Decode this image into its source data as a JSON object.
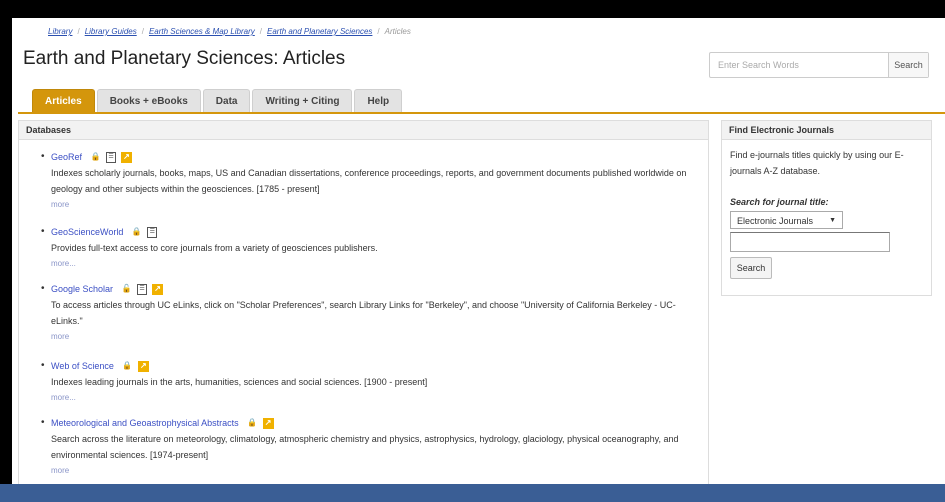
{
  "breadcrumb": {
    "items": [
      "Library",
      "Library Guides",
      "Earth Sciences & Map Library",
      "Earth and Planetary Sciences",
      "Articles"
    ],
    "separator": "/"
  },
  "page_title": "Earth and Planetary Sciences: Articles",
  "search": {
    "placeholder": "Enter Search Words",
    "button_label": "Search"
  },
  "tabs": [
    {
      "label": "Articles",
      "active": true
    },
    {
      "label": "Books + eBooks",
      "active": false
    },
    {
      "label": "Data",
      "active": false
    },
    {
      "label": "Writing + Citing",
      "active": false
    },
    {
      "label": "Help",
      "active": false
    }
  ],
  "databases_box": {
    "title": "Databases",
    "items": [
      {
        "name": "GeoRef",
        "icons": [
          "lock-icon",
          "document-icon",
          "uc-elinks-icon"
        ],
        "description": "Indexes scholarly journals, books, maps, US and Canadian dissertations, conference proceedings, reports, and government documents published worldwide on geology and other subjects within the geosciences. [1785 - present]",
        "more": "more"
      },
      {
        "name": "GeoScienceWorld",
        "icons": [
          "lock-icon",
          "document-icon"
        ],
        "description": "Provides full-text access to core journals from a variety of geosciences publishers.",
        "more": "more..."
      },
      {
        "name": "Google Scholar",
        "icons": [
          "open-lock-icon",
          "document-icon",
          "uc-elinks-icon"
        ],
        "description": "To access articles through UC eLinks, click on \"Scholar Preferences\", search Library Links for \"Berkeley\", and choose \"University of California Berkeley - UC-eLinks.\"",
        "more": "more"
      },
      {
        "name": "Web of Science",
        "icons": [
          "lock-icon",
          "uc-elinks-icon"
        ],
        "description": "Indexes leading journals in the arts, humanities, sciences and social sciences. [1900 - present]",
        "more": "more..."
      },
      {
        "name": "Meteorological and Geoastrophysical Abstracts",
        "icons": [
          "lock-icon",
          "uc-elinks-icon"
        ],
        "description": "Search across the literature on meteorology, climatology, atmospheric chemistry and physics, astrophysics, hydrology, glaciology, physical oceanography, and environmental sciences. [1974-present]",
        "more": "more"
      }
    ]
  },
  "journals_box": {
    "title": "Find Electronic Journals",
    "description": "Find e-journals titles quickly by using our E-journals A-Z database.",
    "search_label": "Search for journal title:",
    "select_value": "Electronic Journals",
    "input_value": "",
    "button_label": "Search"
  },
  "colors": {
    "accent": "#d4960c",
    "link": "#3b4fc4",
    "footer_bar": "#3a5e95"
  }
}
